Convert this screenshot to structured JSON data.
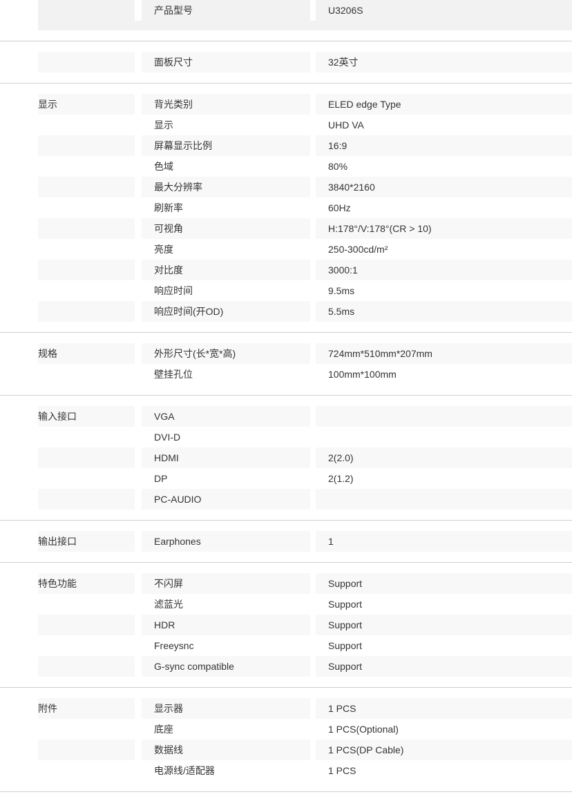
{
  "table": {
    "sections": [
      {
        "group": "",
        "first_partial": true,
        "rows": [
          {
            "item": "产品型号",
            "value": "U3206S"
          }
        ]
      },
      {
        "group": "",
        "rows": [
          {
            "item": "面板尺寸",
            "value": "32英寸"
          }
        ]
      },
      {
        "group": "显示",
        "rows": [
          {
            "item": "背光类别",
            "value": "ELED edge Type"
          },
          {
            "item": "显示",
            "value": "UHD VA"
          },
          {
            "item": "屏幕显示比例",
            "value": "16:9"
          },
          {
            "item": "色域",
            "value": "80%"
          },
          {
            "item": "最大分辨率",
            "value": "3840*2160"
          },
          {
            "item": "刷新率",
            "value": "60Hz"
          },
          {
            "item": "可视角",
            "value": "H:178°/V:178°(CR > 10)"
          },
          {
            "item": "亮度",
            "value": "250-300cd/m²"
          },
          {
            "item": "对比度",
            "value": "3000:1"
          },
          {
            "item": "响应时间",
            "value": "9.5ms"
          },
          {
            "item": "响应时间(开OD)",
            "value": "5.5ms"
          }
        ]
      },
      {
        "group": "规格",
        "rows": [
          {
            "item": "外形尺寸(长*宽*高)",
            "value": "724mm*510mm*207mm"
          },
          {
            "item": "壁挂孔位",
            "value": "100mm*100mm"
          }
        ]
      },
      {
        "group": "输入接口",
        "rows": [
          {
            "item": "VGA",
            "value": ""
          },
          {
            "item": "DVI-D",
            "value": ""
          },
          {
            "item": "HDMI",
            "value": "2(2.0)"
          },
          {
            "item": "DP",
            "value": "2(1.2)"
          },
          {
            "item": "PC-AUDIO",
            "value": ""
          }
        ]
      },
      {
        "group": "输出接口",
        "rows": [
          {
            "item": "Earphones",
            "value": "1"
          }
        ]
      },
      {
        "group": "特色功能",
        "rows": [
          {
            "item": "不闪屏",
            "value": "Support"
          },
          {
            "item": "滤蓝光",
            "value": "Support"
          },
          {
            "item": "HDR",
            "value": "Support"
          },
          {
            "item": "Freeysnc",
            "value": "Support"
          },
          {
            "item": "G-sync compatible",
            "value": "Support"
          }
        ]
      },
      {
        "group": "附件",
        "rows": [
          {
            "item": "显示器",
            "value": "1 PCS"
          },
          {
            "item": "底座",
            "value": "1 PCS(Optional)"
          },
          {
            "item": "数据线",
            "value": "1 PCS(DP Cable)"
          },
          {
            "item": "电源线/适配器",
            "value": "1 PCS"
          }
        ]
      }
    ]
  },
  "colors": {
    "text": "#333333",
    "stripe": "#f8f8f8",
    "stripe_strong": "#f2f2f2",
    "divider": "#cfcfcf",
    "background": "#ffffff"
  }
}
